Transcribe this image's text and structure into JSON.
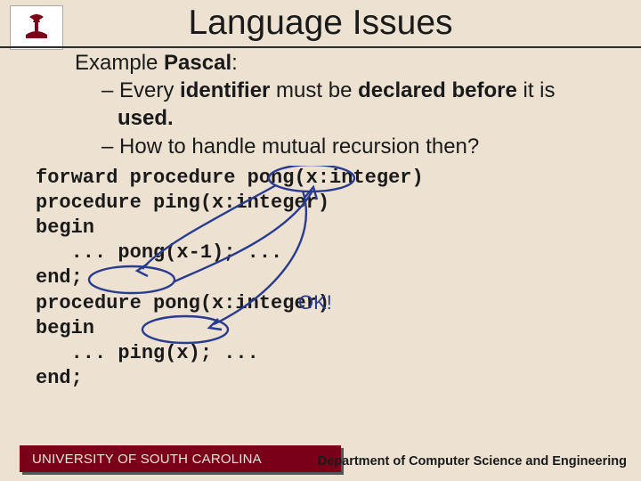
{
  "slide": {
    "title": "Language Issues",
    "example_label_pre": "Example ",
    "example_label_bold": "Pascal",
    "bullet1": "– Every identifier must be declared before it is used.",
    "bullet1_parts": {
      "pre": "– Every ",
      "b1": "identifier",
      "mid": " must be ",
      "b2": "declared before",
      "mid2": " it is ",
      "b3": "used."
    },
    "bullet2": "– How to handle mutual recursion then?"
  },
  "code": {
    "l1": "forward procedure pong(x:integer)",
    "l2": "",
    "l3": "procedure ping(x:integer)",
    "l4": "begin",
    "l5": "   ... pong(x-1); ...",
    "l6": "end;",
    "l7": "procedure pong(x:integer)",
    "l8": "begin",
    "l9": "   ... ping(x); ...",
    "l10": "end;"
  },
  "annotation": {
    "ok": "OK!"
  },
  "footer": {
    "university": "UNIVERSITY OF SOUTH CAROLINA",
    "dept": "Department of Computer Science and Engineering"
  },
  "colors": {
    "garnet": "#7a0019",
    "bg": "#ede2d2",
    "ink": "#2a3c8f"
  }
}
